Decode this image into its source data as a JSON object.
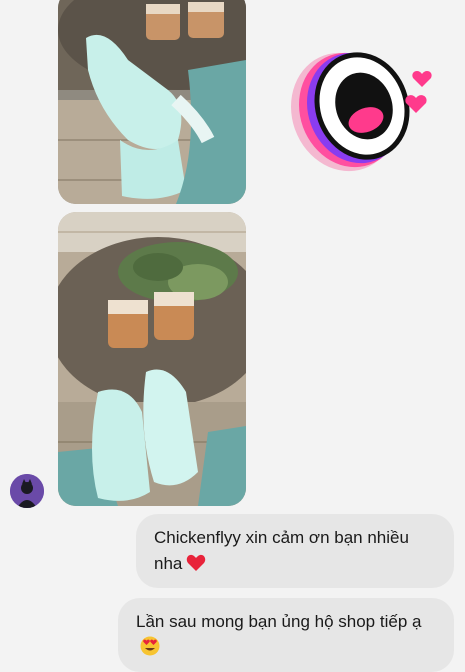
{
  "conversation": {
    "messages": [
      {
        "text": "Chickenflyy xin cảm ơn bạn nhiều nha",
        "emoji": "red-heart"
      },
      {
        "text": "Lần sau mong bạn ủng hộ shop tiếp ạ",
        "emoji": "heart-eyes-face"
      }
    ]
  },
  "colors": {
    "bubble": "#e6e6e6",
    "background": "#f3f3f3",
    "avatar": "#6a4aa8",
    "sticker_purple": "#7b35e6",
    "sticker_pink": "#ff3a8c"
  }
}
